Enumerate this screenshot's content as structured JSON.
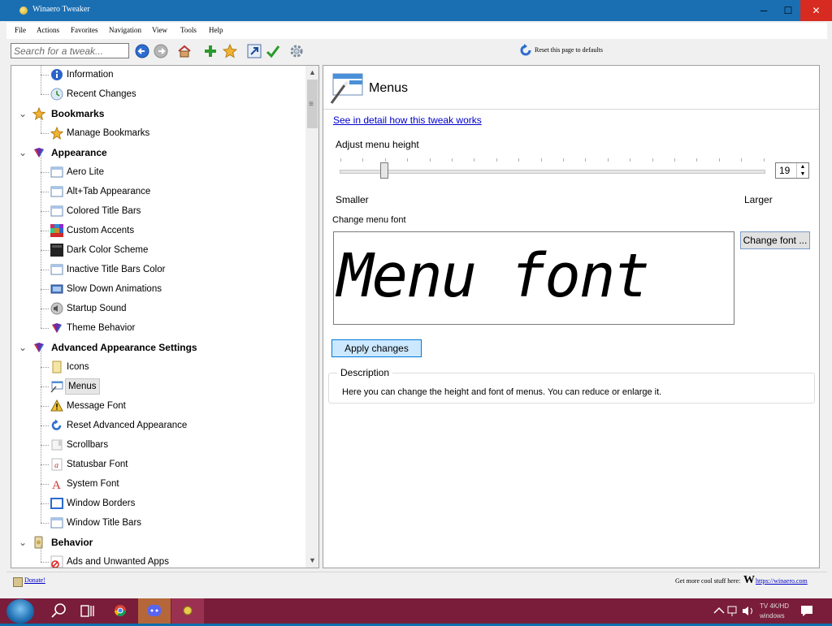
{
  "window": {
    "title": "Winaero Tweaker",
    "min_glyph": "─",
    "max_glyph": "☐",
    "close_glyph": "✕"
  },
  "menubar": {
    "items": [
      "File",
      "Actions",
      "Favorites",
      "Navigation",
      "View",
      "Tools",
      "Help"
    ]
  },
  "toolbar": {
    "search_placeholder": "Search for a tweak...",
    "reset_label": "Reset this page to defaults"
  },
  "tree": {
    "rows": [
      {
        "type": "leaf",
        "label": "Information",
        "icon": "info-icon"
      },
      {
        "type": "leaf",
        "label": "Recent Changes",
        "icon": "recent-changes-icon"
      },
      {
        "type": "cat",
        "label": "Bookmarks",
        "icon": "star-icon"
      },
      {
        "type": "leaf",
        "label": "Manage Bookmarks",
        "icon": "star-icon"
      },
      {
        "type": "cat",
        "label": "Appearance",
        "icon": "appearance-icon"
      },
      {
        "type": "leaf",
        "label": "Aero Lite",
        "icon": "window-icon"
      },
      {
        "type": "leaf",
        "label": "Alt+Tab Appearance",
        "icon": "window-icon"
      },
      {
        "type": "leaf",
        "label": "Colored Title Bars",
        "icon": "window-icon"
      },
      {
        "type": "leaf",
        "label": "Custom Accents",
        "icon": "accents-icon"
      },
      {
        "type": "leaf",
        "label": "Dark Color Scheme",
        "icon": "dark-scheme-icon"
      },
      {
        "type": "leaf",
        "label": "Inactive Title Bars Color",
        "icon": "window-icon"
      },
      {
        "type": "leaf",
        "label": "Slow Down Animations",
        "icon": "animation-icon"
      },
      {
        "type": "leaf",
        "label": "Startup Sound",
        "icon": "speaker-icon"
      },
      {
        "type": "leaf",
        "label": "Theme Behavior",
        "icon": "appearance-icon"
      },
      {
        "type": "cat",
        "label": "Advanced Appearance Settings",
        "icon": "appearance-icon"
      },
      {
        "type": "leaf",
        "label": "Icons",
        "icon": "icons-icon"
      },
      {
        "type": "leaf",
        "label": "Menus",
        "icon": "menus-icon",
        "selected": true
      },
      {
        "type": "leaf",
        "label": "Message Font",
        "icon": "warning-icon"
      },
      {
        "type": "leaf",
        "label": "Reset Advanced Appearance",
        "icon": "reset-icon"
      },
      {
        "type": "leaf",
        "label": "Scrollbars",
        "icon": "scrollbar-icon"
      },
      {
        "type": "leaf",
        "label": "Statusbar Font",
        "icon": "statusbar-font-icon"
      },
      {
        "type": "leaf",
        "label": "System Font",
        "icon": "system-font-icon"
      },
      {
        "type": "leaf",
        "label": "Window Borders",
        "icon": "window-borders-icon"
      },
      {
        "type": "leaf",
        "label": "Window Title Bars",
        "icon": "window-icon"
      },
      {
        "type": "cat",
        "label": "Behavior",
        "icon": "behavior-icon"
      },
      {
        "type": "leaf",
        "label": "Ads and Unwanted Apps",
        "icon": "block-icon"
      }
    ]
  },
  "panel": {
    "title": "Menus",
    "detail_link": "See in detail how this tweak works",
    "adjust_label": "Adjust menu height",
    "slider_value": 19,
    "slider_min_label": "Smaller",
    "slider_max_label": "Larger",
    "change_font_label": "Change menu font",
    "font_sample": "Menu font",
    "change_font_button": "Change font ...",
    "apply_button": "Apply changes",
    "description_title": "Description",
    "description_text": "Here you can change the height and font of menus. You can reduce or enlarge it."
  },
  "statusbar": {
    "donate": "Donate!",
    "cool_stuff": "Get more cool stuff here:",
    "logo_letter": "W",
    "link": "https://winaero.com"
  },
  "taskbar": {
    "tray_text_1": "TV 4K/HD",
    "tray_text_2": "windows"
  },
  "colors": {
    "titlebar": "#1a6fb3",
    "close": "#d72b21",
    "taskbar": "#7a1d3a",
    "apply_bg": "#cce8ff",
    "link": "#0000cc"
  }
}
